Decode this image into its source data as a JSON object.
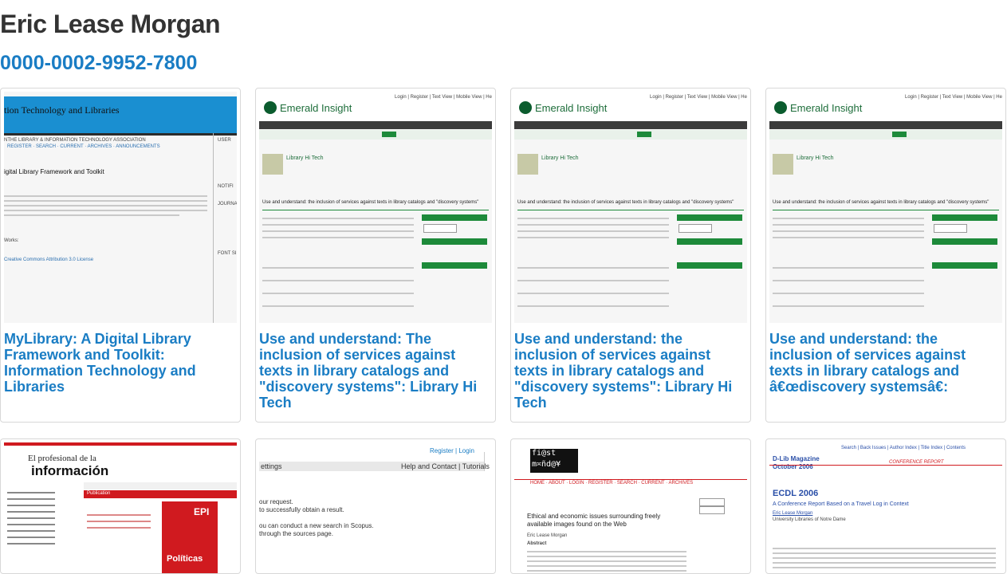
{
  "profile": {
    "name": "Eric Lease Morgan",
    "orcid": "0000-0002-9952-7800"
  },
  "cards": [
    {
      "title": "MyLibrary: A Digital Library Framework and Toolkit: Information Technology and Libraries",
      "thumb_heading": "tion Technology and Libraries",
      "thumb_sub": "igital Library Framework and Toolkit"
    },
    {
      "title": "Use and understand: The inclusion of services against texts in library catalogs and \"discovery systems\": Library Hi Tech",
      "thumb_heading": "Emerald Insight",
      "thumb_sub": "Use and understand: the inclusion of services against texts in library catalogs and \"discovery systems\""
    },
    {
      "title": "Use and understand: the inclusion of services against texts in library catalogs and \"discovery systems\": Library Hi Tech",
      "thumb_heading": "Emerald Insight",
      "thumb_sub": "Use and understand: the inclusion of services against texts in library catalogs and \"discovery systems\""
    },
    {
      "title": "Use and understand: the inclusion of services against texts in library catalogs and â€œdiscovery systemsâ€:",
      "thumb_heading": "Emerald Insight",
      "thumb_sub": "Use and understand: the inclusion of services against texts in library catalogs and \"discovery systems\""
    }
  ],
  "row2": [
    {
      "heading": "El profesional de la",
      "heading2": "información",
      "cover": "EPI",
      "cover_sub": "Políticas"
    },
    {
      "register": "Register",
      "login": "Login",
      "settings": "ettings",
      "help": "Help and Contact",
      "tutorials": "Tutorials",
      "l1": "our request.",
      "l2": "to successfully obtain a result.",
      "l3": "ou can conduct a new search in Scopus.",
      "l4": "through the sources page."
    },
    {
      "logo1": "fi@st",
      "logo2": "m≍ñd@¥",
      "text1": "Ethical and economic issues surrounding freely available images found on the Web",
      "author": "Eric Lease Morgan",
      "abstract": "Abstract"
    },
    {
      "mag": "D-Lib Magazine",
      "date": "October 2006",
      "banner": "CONFERENCE REPORT",
      "title": "ECDL 2006",
      "subtitle": "A Conference Report Based on a Travel Log in Context",
      "author": "Eric Lease Morgan",
      "affil": "University Libraries of Notre Dame"
    }
  ],
  "colors": {
    "link": "#1a7dc4",
    "emerald": "#1d8a3a",
    "ital_blue": "#1a8fd1",
    "epi_red": "#d01a1f"
  }
}
